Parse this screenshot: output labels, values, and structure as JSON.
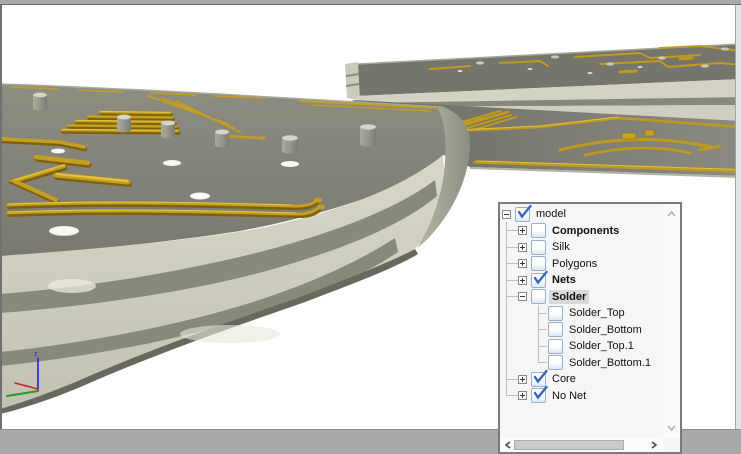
{
  "window": {
    "viewport_background": "#ffffff",
    "frame_gray": "#a9a9a9",
    "frame_line": "#6e6e6e"
  },
  "scene": {
    "description_colors": {
      "board_top_surface": "#84837a",
      "board_edge_light_band": "#d3d2c5",
      "board_edge_dark_band": "#878a7a",
      "copper_gold": "#c49f22",
      "copper_highlight": "#e6c53b",
      "hole_white": "#f8f8f2"
    },
    "axis_triad": {
      "z_label": "z",
      "x_color": "#cc2222",
      "y_color": "#22a022",
      "z_color": "#2424cc"
    }
  },
  "model_tree": {
    "items": [
      {
        "label": "model",
        "level": 0,
        "bold": false,
        "checked": true,
        "selected": false,
        "expander": "minus"
      },
      {
        "label": "Components",
        "level": 1,
        "bold": true,
        "checked": false,
        "selected": false,
        "expander": "plus"
      },
      {
        "label": "Silk",
        "level": 1,
        "bold": false,
        "checked": false,
        "selected": false,
        "expander": "plus"
      },
      {
        "label": "Polygons",
        "level": 1,
        "bold": false,
        "checked": false,
        "selected": false,
        "expander": "plus"
      },
      {
        "label": "Nets",
        "level": 1,
        "bold": true,
        "checked": true,
        "selected": false,
        "expander": "plus"
      },
      {
        "label": "Solder",
        "level": 1,
        "bold": true,
        "checked": false,
        "selected": true,
        "expander": "minus"
      },
      {
        "label": "Solder_Top",
        "level": 2,
        "bold": false,
        "checked": false,
        "selected": false,
        "expander": null
      },
      {
        "label": "Solder_Bottom",
        "level": 2,
        "bold": false,
        "checked": false,
        "selected": false,
        "expander": null
      },
      {
        "label": "Solder_Top.1",
        "level": 2,
        "bold": false,
        "checked": false,
        "selected": false,
        "expander": null
      },
      {
        "label": "Solder_Bottom.1",
        "level": 2,
        "bold": false,
        "checked": false,
        "selected": false,
        "expander": null
      },
      {
        "label": "Core",
        "level": 1,
        "bold": false,
        "checked": true,
        "selected": false,
        "expander": "plus"
      },
      {
        "label": "No Net",
        "level": 1,
        "bold": false,
        "checked": true,
        "selected": false,
        "expander": "plus"
      }
    ]
  }
}
